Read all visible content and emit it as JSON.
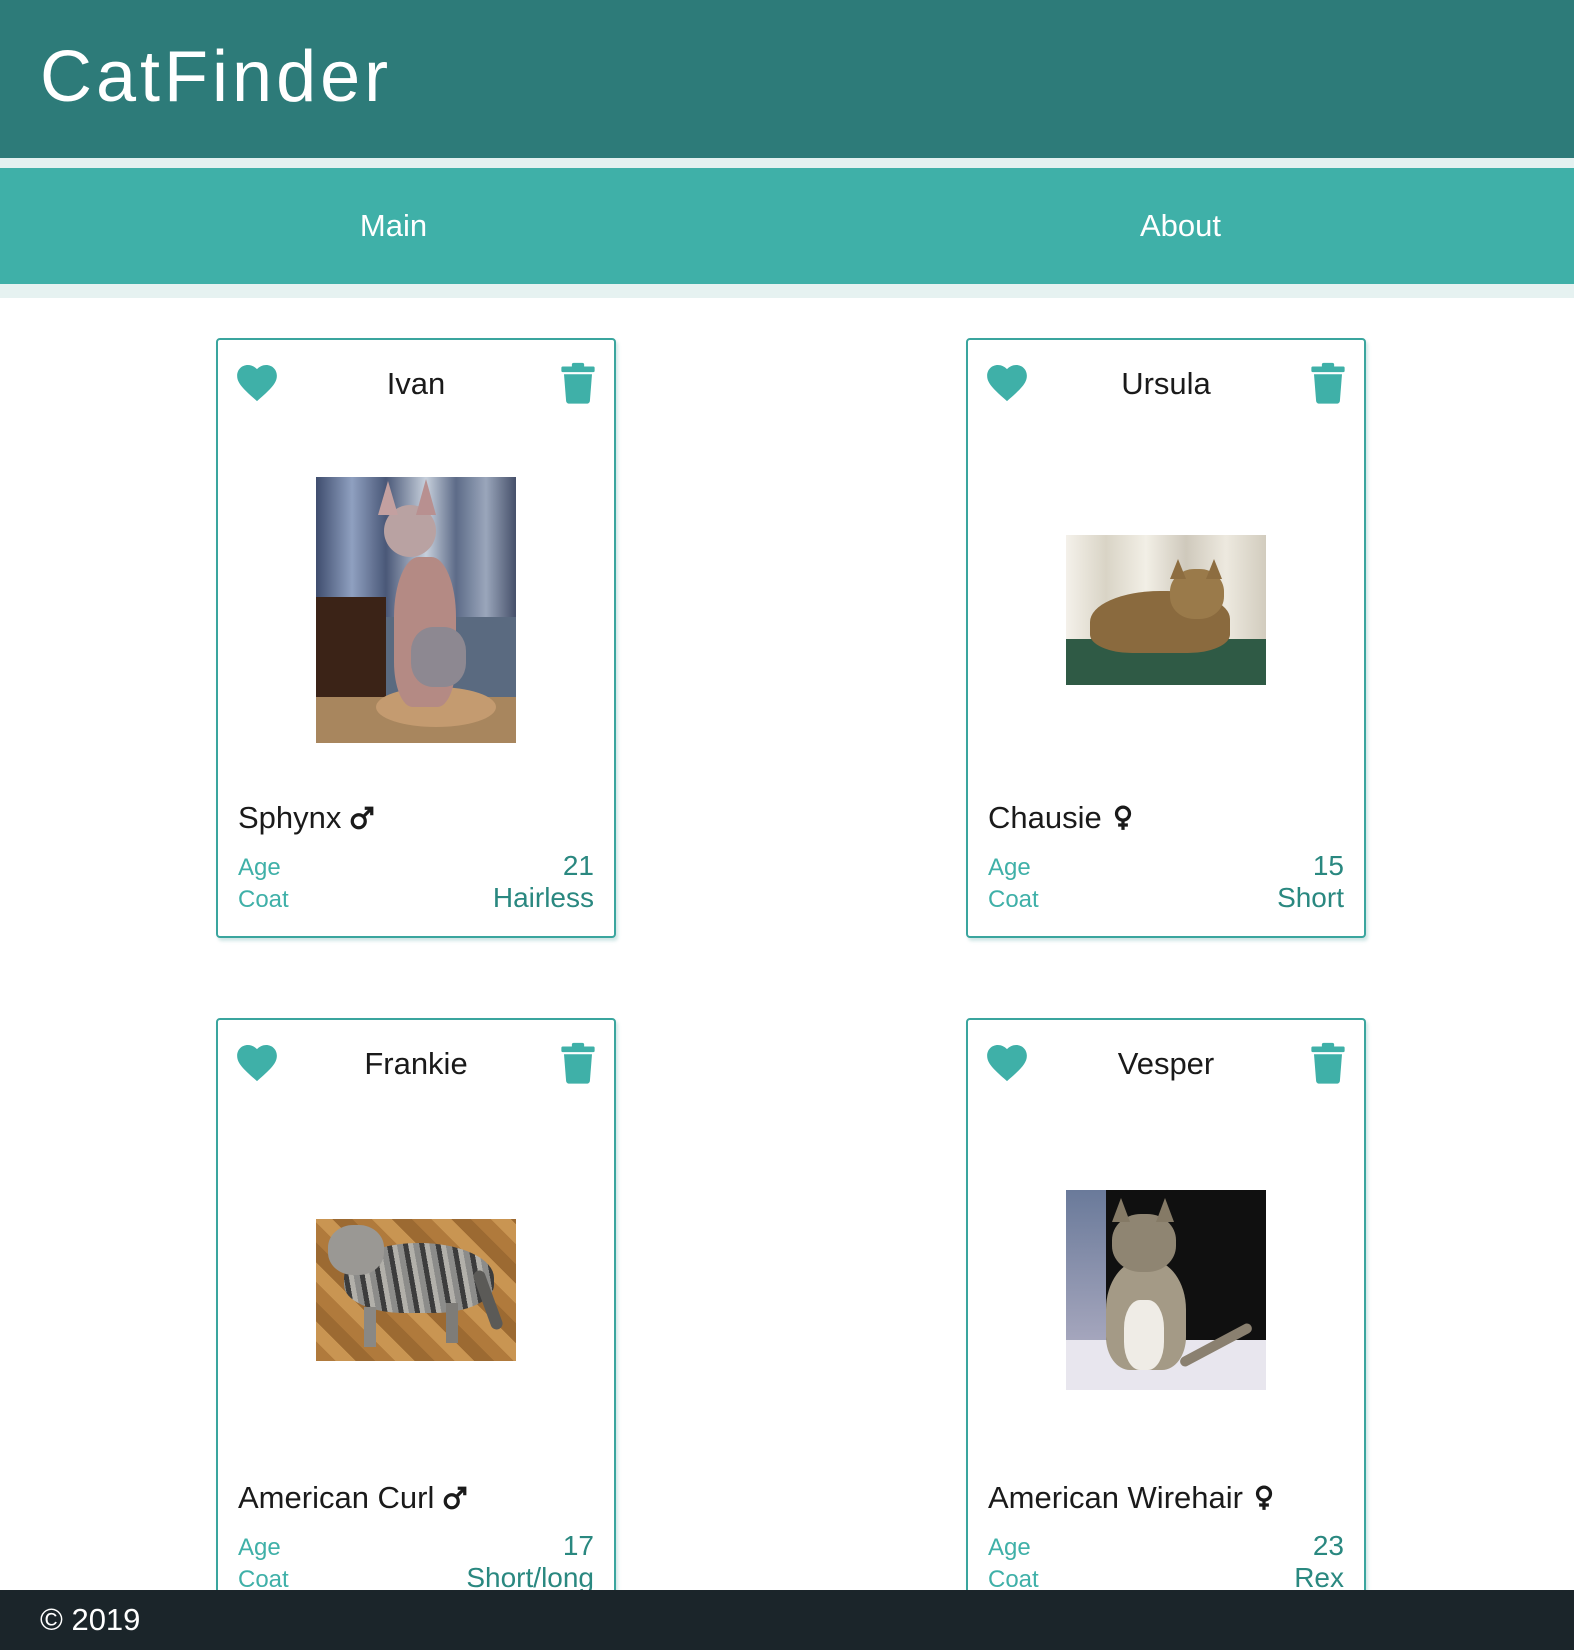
{
  "app": {
    "title": "CatFinder"
  },
  "nav": {
    "items": [
      {
        "label": "Main"
      },
      {
        "label": "About"
      }
    ]
  },
  "colors": {
    "header": "#2d7b79",
    "nav": "#3fb0a8",
    "accent": "#3fb0a8",
    "value_text": "#2a8880",
    "footer": "#1b252a"
  },
  "cards": [
    {
      "name": "Ivan",
      "breed": "Sphynx",
      "sex_icon": "male-icon",
      "age_label": "Age",
      "age": "21",
      "coat_label": "Coat",
      "coat": "Hairless",
      "photo": "sphynx-cat-photo"
    },
    {
      "name": "Ursula",
      "breed": "Chausie",
      "sex_icon": "female-icon",
      "age_label": "Age",
      "age": "15",
      "coat_label": "Coat",
      "coat": "Short",
      "photo": "chausie-cat-photo"
    },
    {
      "name": "Frankie",
      "breed": "American Curl",
      "sex_icon": "male-icon",
      "age_label": "Age",
      "age": "17",
      "coat_label": "Coat",
      "coat": "Short/long",
      "photo": "american-curl-cat-photo"
    },
    {
      "name": "Vesper",
      "breed": "American Wirehair",
      "sex_icon": "female-icon",
      "age_label": "Age",
      "age": "23",
      "coat_label": "Coat",
      "coat": "Rex",
      "photo": "american-wirehair-cat-photo"
    }
  ],
  "icons": {
    "favorite": "heart-icon",
    "delete": "trash-icon"
  },
  "footer": {
    "text": "© 2019"
  }
}
